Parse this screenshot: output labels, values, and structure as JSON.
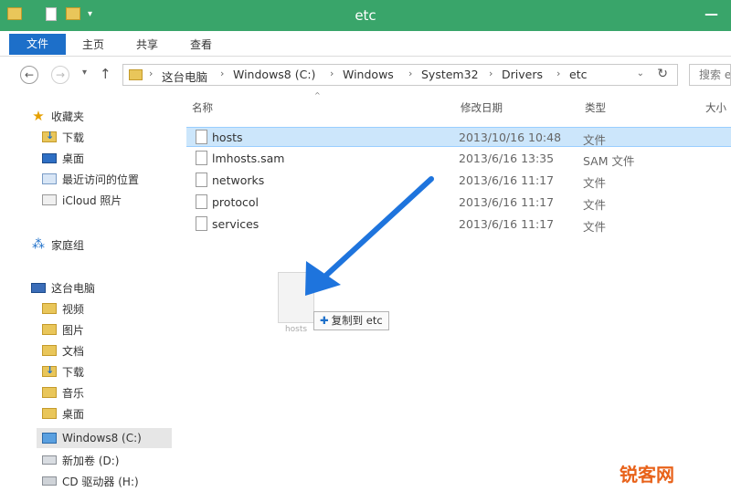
{
  "window": {
    "title": "etc",
    "minimize_glyph": "—",
    "title_color": "#39a56a",
    "quick_access_dropdown": "▾"
  },
  "ribbon": {
    "file_tab": "文件",
    "tabs": [
      "主页",
      "共享",
      "查看"
    ],
    "file_tab_color": "#1d6fc9"
  },
  "address": {
    "back": "←",
    "forward": "→",
    "history_dropdown": "▾",
    "up": "↑",
    "crumbs": [
      "这台电脑",
      "Windows8 (C:)",
      "Windows",
      "System32",
      "Drivers",
      "etc"
    ],
    "separator": "›",
    "dropdown": "⌄",
    "refresh": "↻",
    "search_placeholder": "搜索 etc"
  },
  "sidebar": {
    "favorites": {
      "label": "收藏夹",
      "icon": "star-icon"
    },
    "favorites_items": [
      {
        "label": "下载",
        "icon": "downloads-folder-icon"
      },
      {
        "label": "桌面",
        "icon": "desktop-icon"
      },
      {
        "label": "最近访问的位置",
        "icon": "recent-places-icon"
      },
      {
        "label": "iCloud 照片",
        "icon": "icloud-photos-icon"
      }
    ],
    "homegroup": {
      "label": "家庭组",
      "icon": "homegroup-icon"
    },
    "this_pc": {
      "label": "这台电脑",
      "icon": "computer-icon"
    },
    "pc_items": [
      {
        "label": "视频",
        "icon": "folder-icon"
      },
      {
        "label": "图片",
        "icon": "folder-icon"
      },
      {
        "label": "文档",
        "icon": "folder-icon"
      },
      {
        "label": "下载",
        "icon": "downloads-folder-icon"
      },
      {
        "label": "音乐",
        "icon": "folder-icon"
      },
      {
        "label": "桌面",
        "icon": "folder-icon"
      },
      {
        "label": "Windows8 (C:)",
        "icon": "windows-drive-icon"
      },
      {
        "label": "新加卷 (D:)",
        "icon": "drive-icon"
      },
      {
        "label": "CD 驱动器 (H:)",
        "icon": "cd-drive-icon"
      }
    ]
  },
  "file_list": {
    "columns": {
      "name": "名称",
      "date": "修改日期",
      "type": "类型",
      "size": "大小"
    },
    "sort_indicator": "^",
    "files": [
      {
        "name": "hosts",
        "date": "2013/10/16 10:48",
        "type": "文件",
        "selected": true
      },
      {
        "name": "lmhosts.sam",
        "date": "2013/6/16 13:35",
        "type": "SAM 文件",
        "selected": false
      },
      {
        "name": "networks",
        "date": "2013/6/16 11:17",
        "type": "文件",
        "selected": false
      },
      {
        "name": "protocol",
        "date": "2013/6/16 11:17",
        "type": "文件",
        "selected": false
      },
      {
        "name": "services",
        "date": "2013/6/16 11:17",
        "type": "文件",
        "selected": false
      }
    ]
  },
  "drag": {
    "ghost_label": "hosts",
    "tooltip_plus": "✚",
    "tooltip_text": "复制到 etc"
  },
  "annotation": {
    "arrow_color": "#1e74dd"
  },
  "watermark": "锐客网"
}
